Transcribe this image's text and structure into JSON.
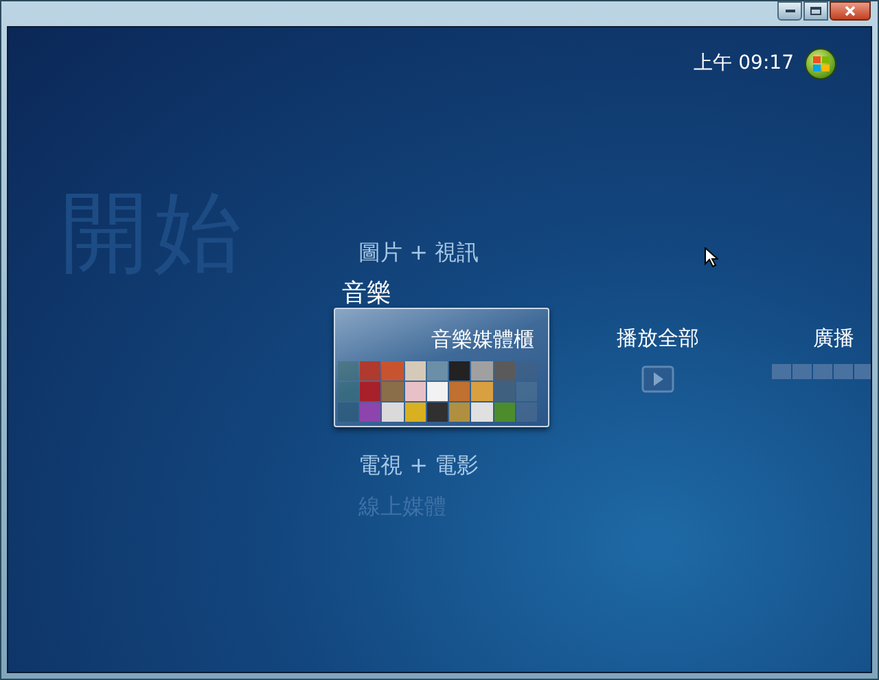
{
  "clock": "上午 09:17",
  "heading": "開始",
  "menu": [
    {
      "label": "圖片 + 視訊",
      "selected": false
    },
    {
      "label": "音樂",
      "selected": true,
      "tiles": [
        {
          "label": "音樂媒體櫃",
          "kind": "library",
          "selected": true
        },
        {
          "label": "播放全部",
          "kind": "play",
          "selected": false
        },
        {
          "label": "廣播",
          "kind": "radio",
          "selected": false
        }
      ]
    },
    {
      "label": "電視 + 電影",
      "selected": false
    },
    {
      "label": "線上媒體",
      "selected": false,
      "faded": true
    }
  ]
}
